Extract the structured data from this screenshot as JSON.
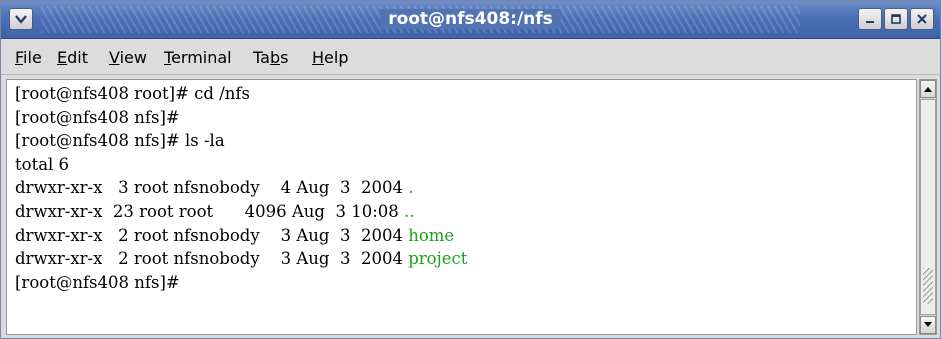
{
  "window": {
    "title": "root@nfs408:/nfs"
  },
  "menu": {
    "items": [
      {
        "pre": "",
        "u": "F",
        "post": "ile"
      },
      {
        "pre": "",
        "u": "E",
        "post": "dit"
      },
      {
        "pre": "",
        "u": "V",
        "post": "iew"
      },
      {
        "pre": "",
        "u": "T",
        "post": "erminal"
      },
      {
        "pre": "Ta",
        "u": "b",
        "post": "s"
      },
      {
        "pre": "",
        "u": "H",
        "post": "elp"
      }
    ]
  },
  "terminal": {
    "lines": [
      "[root@nfs408 root]# cd /nfs",
      "[root@nfs408 nfs]#",
      "[root@nfs408 nfs]# ls -la",
      "total 6"
    ],
    "entries": [
      {
        "prefix": "drwxr-xr-x   3 root nfsnobody    4 Aug  3  2004 ",
        "name": "."
      },
      {
        "prefix": "drwxr-xr-x  23 root root      4096 Aug  3 10:08 ",
        "name": ".."
      },
      {
        "prefix": "drwxr-xr-x   2 root nfsnobody    3 Aug  3  2004 ",
        "name": "home"
      },
      {
        "prefix": "drwxr-xr-x   2 root nfsnobody    3 Aug  3  2004 ",
        "name": "project"
      }
    ],
    "last_prompt": "[root@nfs408 nfs]#"
  },
  "colors": {
    "title_bar": "#4b70b5",
    "directory_name": "#1aa31a",
    "terminal_bg": "#ffffff"
  },
  "icons": {
    "window_menu": "chevron-down-icon",
    "minimize": "minimize-icon",
    "maximize": "maximize-icon",
    "close": "close-icon",
    "scroll_up": "arrow-up-icon",
    "scroll_down": "arrow-down-icon"
  }
}
